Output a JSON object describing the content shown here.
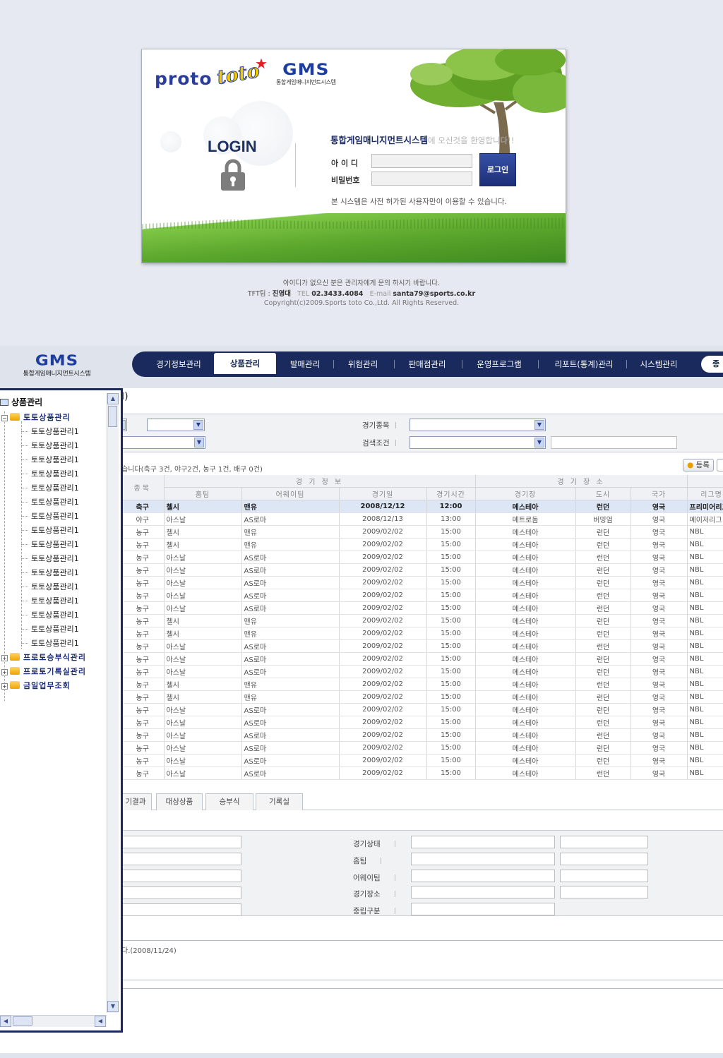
{
  "login": {
    "logo_proto": "proto",
    "logo_toto": "toto",
    "gms_title": "GMS",
    "gms_subtitle": "통합게임매니지먼트시스템",
    "login_heading": "LOGIN",
    "welcome_bold": "통합게임매니지먼트시스템",
    "welcome_rest": "에 오신것을 환영합니다!!",
    "id_label": "아 이 디",
    "password_label": "비밀번호",
    "id_value": "",
    "password_value": "",
    "login_button": "로그인",
    "notice": "본 시스템은 사전 허가된 사용자만이 이용할 수 있습니다.",
    "footer_line1": "아이디가 없으신 분은 관리자에게 문의 하시기 바랍니다.",
    "footer_team_label": "TFT팀 :",
    "footer_team_name": "진영대",
    "footer_tel_label": "TEL",
    "footer_tel": "02.3433.4084",
    "footer_email_label": "E-mail",
    "footer_email": "santa79@sports.co.kr",
    "footer_copyright": "Copyright(c)2009.Sports toto Co.,Ltd. All Rights Reserved."
  },
  "header": {
    "gms_title": "GMS",
    "gms_subtitle": "통합게임매니지먼트시스템",
    "nav": [
      "경기정보관리",
      "상품관리",
      "발매관리",
      "위험관리",
      "판매점관리",
      "운영프로그램",
      "리포트(통계)관리",
      "시스템관리"
    ],
    "active_nav": "상품관리",
    "exit_label": "종"
  },
  "sidebar": {
    "root": "상품관리",
    "folder_open": "토토상품관리",
    "children": [
      "토토상품관리1",
      "토토상품관리1",
      "토토상품관리1",
      "토토상품관리1",
      "토토상품관리1",
      "토토상품관리1",
      "토토상품관리1",
      "토토상품관리1",
      "토토상품관리1",
      "토토상품관리1",
      "토토상품관리1",
      "토토상품관리1",
      "토토상품관리1",
      "토토상품관리1",
      "토토상품관리1",
      "토토상품관리1"
    ],
    "folders_closed": [
      "프로토승부식관리",
      "프로토기록실관리",
      "금일업무조회"
    ]
  },
  "content": {
    "page_title": "I)",
    "filters": {
      "game_type_label": "경기종목",
      "search_label": "검색조건",
      "search_value": ""
    },
    "summary": "습니다(축구 3건, 야구2건, 농구 1건, 배구 0건)",
    "register_button": "등록",
    "table": {
      "group_headers": [
        "경 기 정 보",
        "경 기 장 소"
      ],
      "col_sport": "종목",
      "columns": [
        "홈팀",
        "어웨이팀",
        "경기일",
        "경기시간",
        "경기장",
        "도시",
        "국가",
        "리그명"
      ],
      "rows": [
        [
          "축구",
          "첼시",
          "맨유",
          "2008/12/12",
          "12:00",
          "메스테아",
          "런던",
          "영국",
          "프리미어리그"
        ],
        [
          "야구",
          "아스날",
          "AS로마",
          "2008/12/13",
          "13:00",
          "메트로돔",
          "버밍엄",
          "영국",
          "메이저리그"
        ],
        [
          "농구",
          "첼시",
          "맨유",
          "2009/02/02",
          "15:00",
          "메스테아",
          "런던",
          "영국",
          "NBL"
        ],
        [
          "농구",
          "첼시",
          "맨유",
          "2009/02/02",
          "15:00",
          "메스테아",
          "런던",
          "영국",
          "NBL"
        ],
        [
          "농구",
          "아스날",
          "AS로마",
          "2009/02/02",
          "15:00",
          "메스테아",
          "런던",
          "영국",
          "NBL"
        ],
        [
          "농구",
          "아스날",
          "AS로마",
          "2009/02/02",
          "15:00",
          "메스테아",
          "런던",
          "영국",
          "NBL"
        ],
        [
          "농구",
          "아스날",
          "AS로마",
          "2009/02/02",
          "15:00",
          "메스테아",
          "런던",
          "영국",
          "NBL"
        ],
        [
          "농구",
          "아스날",
          "AS로마",
          "2009/02/02",
          "15:00",
          "메스테아",
          "런던",
          "영국",
          "NBL"
        ],
        [
          "농구",
          "아스날",
          "AS로마",
          "2009/02/02",
          "15:00",
          "메스테아",
          "런던",
          "영국",
          "NBL"
        ],
        [
          "농구",
          "첼시",
          "맨유",
          "2009/02/02",
          "15:00",
          "메스테아",
          "런던",
          "영국",
          "NBL"
        ],
        [
          "농구",
          "첼시",
          "맨유",
          "2009/02/02",
          "15:00",
          "메스테아",
          "런던",
          "영국",
          "NBL"
        ],
        [
          "농구",
          "아스날",
          "AS로마",
          "2009/02/02",
          "15:00",
          "메스테아",
          "런던",
          "영국",
          "NBL"
        ],
        [
          "농구",
          "아스날",
          "AS로마",
          "2009/02/02",
          "15:00",
          "메스테아",
          "런던",
          "영국",
          "NBL"
        ],
        [
          "농구",
          "아스날",
          "AS로마",
          "2009/02/02",
          "15:00",
          "메스테아",
          "런던",
          "영국",
          "NBL"
        ],
        [
          "농구",
          "첼시",
          "맨유",
          "2009/02/02",
          "15:00",
          "메스테아",
          "런던",
          "영국",
          "NBL"
        ],
        [
          "농구",
          "첼시",
          "맨유",
          "2009/02/02",
          "15:00",
          "메스테아",
          "런던",
          "영국",
          "NBL"
        ],
        [
          "농구",
          "아스날",
          "AS로마",
          "2009/02/02",
          "15:00",
          "메스테아",
          "런던",
          "영국",
          "NBL"
        ],
        [
          "농구",
          "아스날",
          "AS로마",
          "2009/02/02",
          "15:00",
          "메스테아",
          "런던",
          "영국",
          "NBL"
        ],
        [
          "농구",
          "아스날",
          "AS로마",
          "2009/02/02",
          "15:00",
          "메스테아",
          "런던",
          "영국",
          "NBL"
        ],
        [
          "농구",
          "아스날",
          "AS로마",
          "2009/02/02",
          "15:00",
          "메스테아",
          "런던",
          "영국",
          "NBL"
        ],
        [
          "농구",
          "아스날",
          "AS로마",
          "2009/02/02",
          "15:00",
          "메스테아",
          "런던",
          "영국",
          "NBL"
        ],
        [
          "농구",
          "아스날",
          "AS로마",
          "2009/02/02",
          "15:00",
          "메스테아",
          "런던",
          "영국",
          "NBL"
        ]
      ]
    },
    "tabs": [
      "기결과",
      "대상상품",
      "승부식",
      "기록실"
    ],
    "detail_labels": [
      "경기상태",
      "홈팀",
      "어웨이팀",
      "경기장소",
      "중립구분"
    ],
    "memo": "다.(2008/11/24)"
  }
}
